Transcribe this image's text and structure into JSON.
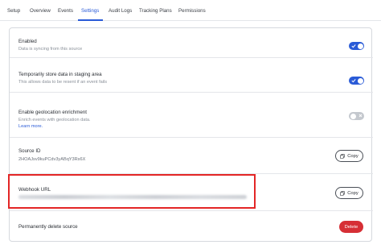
{
  "tabs": [
    {
      "label": "Setup",
      "active": false
    },
    {
      "label": "Overview",
      "active": false
    },
    {
      "label": "Events",
      "active": false
    },
    {
      "label": "Settings",
      "active": true
    },
    {
      "label": "Audit Logs",
      "active": false
    },
    {
      "label": "Tracking Plans",
      "active": false
    },
    {
      "label": "Permissions",
      "active": false
    }
  ],
  "settings": {
    "enabled": {
      "title": "Enabled",
      "description": "Data is syncing from this source",
      "toggle_on": true
    },
    "staging": {
      "title": "Temporarily store data in staging area",
      "description": "This allows data to be resent if an event fails",
      "toggle_on": true
    },
    "geolocation": {
      "title": "Enable geolocation enrichment",
      "description": "Enrich events with geolocation data.",
      "link": "Learn more.",
      "toggle_on": false
    },
    "source_id": {
      "title": "Source ID",
      "value": "2HOAJsv9kuPCdv3yABqY3Rs6X",
      "copy_label": "Copy"
    },
    "webhook": {
      "title": "Webhook URL",
      "value_redacted": true,
      "copy_label": "Copy"
    },
    "delete": {
      "title": "Permanently delete source",
      "button_label": "Delete"
    }
  },
  "colors": {
    "accent": "#2a5bd7",
    "danger": "#d62f35",
    "highlight": "#e32626",
    "toggle_off": "#c4c8ce"
  },
  "icons": {
    "copy": "copy-icon",
    "check": "check-icon",
    "cross": "x-icon"
  }
}
